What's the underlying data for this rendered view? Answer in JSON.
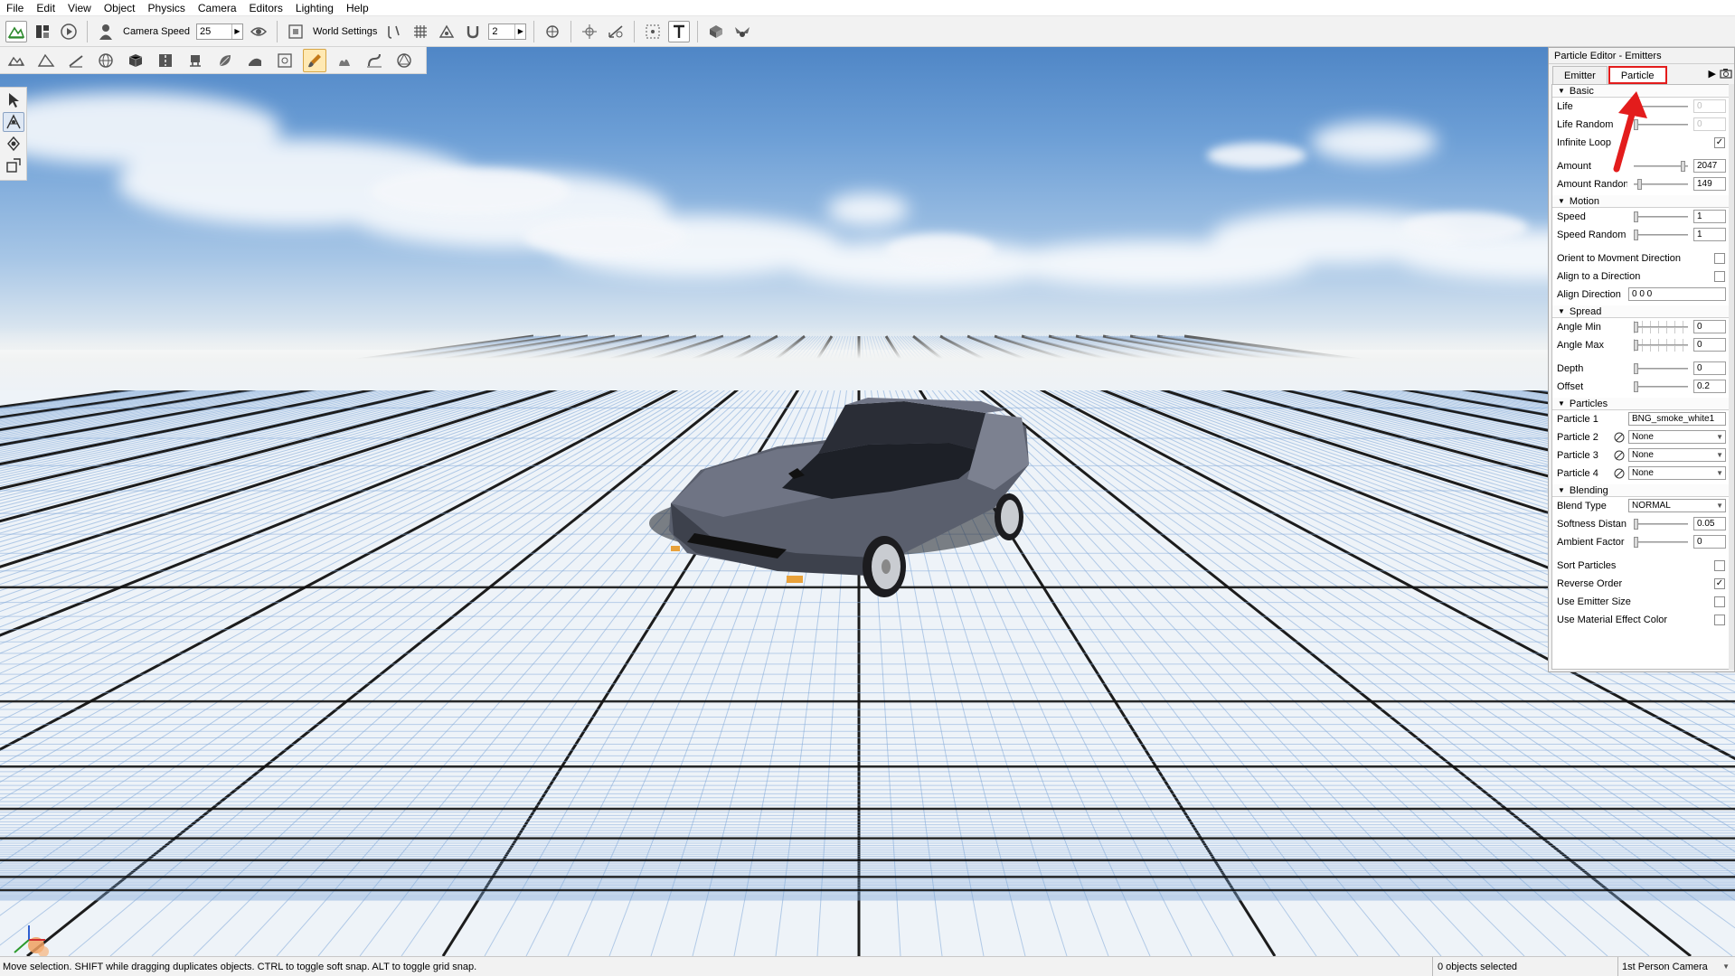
{
  "menu": [
    "File",
    "Edit",
    "View",
    "Object",
    "Physics",
    "Camera",
    "Editors",
    "Lighting",
    "Help"
  ],
  "toolbar": {
    "camera_speed_label": "Camera Speed",
    "camera_speed_value": "25",
    "world_settings_label": "World Settings",
    "grid_value": "2"
  },
  "panel": {
    "title": "Particle Editor - Emitters",
    "tabs": [
      "Emitter",
      "Particle"
    ],
    "active_tab": "Particle",
    "sections": {
      "basic": "Basic",
      "motion": "Motion",
      "spread": "Spread",
      "particles": "Particles",
      "blending": "Blending"
    },
    "basic": {
      "life_label": "Life",
      "life_value": "0",
      "life_random_label": "Life Random",
      "life_random_value": "0",
      "infinite_loop_label": "Infinite Loop",
      "infinite_loop_checked": true,
      "amount_label": "Amount",
      "amount_value": "2047",
      "amount_random_label": "Amount Randon",
      "amount_random_value": "149"
    },
    "motion": {
      "speed_label": "Speed",
      "speed_value": "1",
      "speed_random_label": "Speed Random",
      "speed_random_value": "1",
      "orient_label": "Orient to Movment Direction",
      "orient_checked": false,
      "align_label": "Align to a Direction",
      "align_checked": false,
      "align_dir_label": "Align Direction",
      "align_dir_value": "0 0 0"
    },
    "spread": {
      "angle_min_label": "Angle Min",
      "angle_min_value": "0",
      "angle_max_label": "Angle Max",
      "angle_max_value": "0",
      "depth_label": "Depth",
      "depth_value": "0",
      "offset_label": "Offset",
      "offset_value": "0.2"
    },
    "particles": {
      "p1_label": "Particle 1",
      "p1_value": "BNG_smoke_white1",
      "p2_label": "Particle 2",
      "p2_value": "None",
      "p3_label": "Particle 3",
      "p3_value": "None",
      "p4_label": "Particle 4",
      "p4_value": "None"
    },
    "blending": {
      "blend_type_label": "Blend Type",
      "blend_type_value": "NORMAL",
      "softness_label": "Softness Distan",
      "softness_value": "0.05",
      "ambient_label": "Ambient Factor",
      "ambient_value": "0",
      "sort_label": "Sort Particles",
      "sort_checked": false,
      "reverse_label": "Reverse Order",
      "reverse_checked": true,
      "emitter_size_label": "Use Emitter Size",
      "emitter_size_checked": false,
      "material_color_label": "Use Material Effect Color",
      "material_color_checked": false
    }
  },
  "status": {
    "message": "Move selection.  SHIFT while dragging duplicates objects.  CTRL to toggle soft snap.  ALT to toggle grid snap.",
    "selection": "0 objects selected",
    "camera": "1st Person Camera"
  },
  "colors": {
    "highlight_red": "#e31c1c",
    "car_body": "#6b6f7d",
    "grid_line": "#7fa7d8"
  },
  "icons": {
    "toolbar1": [
      "terrain-editor-icon",
      "layout-icon",
      "play-icon",
      "person-icon",
      "eye-icon",
      "frame-icon",
      "snap-icon",
      "grid-icon",
      "vertex-icon",
      "magnet-icon",
      "object-icon",
      "transform-icon",
      "measure-icon",
      "select-box-icon",
      "text-icon",
      "material-icon",
      "wings-icon"
    ],
    "toolbar2": [
      "terrain-icon",
      "mountain-icon",
      "ruler-icon",
      "globe-icon",
      "cube-icon",
      "road-icon",
      "mesh-icon",
      "leaf-icon",
      "decal-icon",
      "bounds-icon",
      "brush-icon",
      "foliage-icon",
      "river-icon",
      "shape-icon"
    ],
    "leftstrip": [
      "pointer-icon",
      "move-icon",
      "rotate-icon",
      "scale-icon"
    ]
  }
}
